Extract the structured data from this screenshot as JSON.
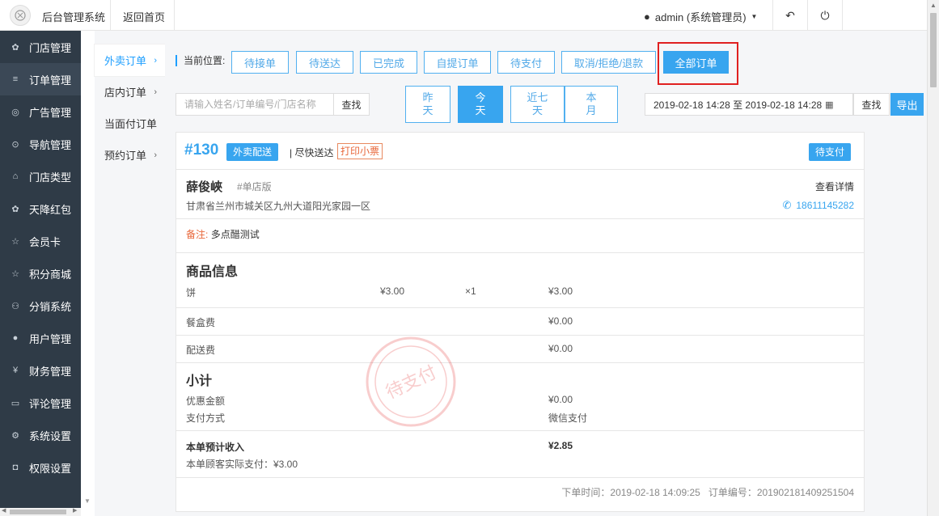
{
  "header": {
    "app_title": "后台管理系统",
    "back_home": "返回首页",
    "user": "admin (系统管理员)",
    "back_icon": "↶",
    "power_icon": "⏻"
  },
  "sidebar": {
    "items": [
      {
        "icon": "✿",
        "label": "门店管理"
      },
      {
        "icon": "≡",
        "label": "订单管理"
      },
      {
        "icon": "◎",
        "label": "广告管理"
      },
      {
        "icon": "⊙",
        "label": "导航管理"
      },
      {
        "icon": "⌂",
        "label": "门店类型"
      },
      {
        "icon": "✿",
        "label": "天降红包"
      },
      {
        "icon": "☆",
        "label": "会员卡"
      },
      {
        "icon": "☆",
        "label": "积分商城"
      },
      {
        "icon": "⚇",
        "label": "分销系统"
      },
      {
        "icon": "●",
        "label": "用户管理"
      },
      {
        "icon": "¥",
        "label": "财务管理"
      },
      {
        "icon": "▭",
        "label": "评论管理"
      },
      {
        "icon": "⚙",
        "label": "系统设置"
      },
      {
        "icon": "◘",
        "label": "权限设置"
      }
    ]
  },
  "subnav": {
    "items": [
      {
        "label": "外卖订单",
        "chev": "›"
      },
      {
        "label": "店内订单",
        "chev": "›"
      },
      {
        "label": "当面付订单",
        "chev": ""
      },
      {
        "label": "预约订单",
        "chev": "›"
      }
    ]
  },
  "filters": {
    "position_label": "当前位置:",
    "tabs": [
      "待接单",
      "待送达",
      "已完成",
      "自提订单",
      "待支付",
      "取消/拒绝/退款",
      "全部订单"
    ],
    "search_placeholder": "请输入姓名/订单编号/门店名称",
    "search_button": "查找",
    "days": [
      {
        "l1": "昨",
        "l2": "天"
      },
      {
        "l1": "今",
        "l2": "天"
      },
      {
        "l1": "近七",
        "l2": "天"
      },
      {
        "l1": "本",
        "l2": "月"
      }
    ],
    "date_range": "2019-02-18 14:28 至 2019-02-18 14:28",
    "date_search_button": "查找",
    "export_button": "导出"
  },
  "order": {
    "number": "#130",
    "type": "外卖配送",
    "delivery": "| 尽快送达",
    "print": "打印小票",
    "status": "待支付",
    "customer_name": "薛俊峽",
    "store_tag": "#单店版",
    "view_detail": "查看详情",
    "address": "甘肃省兰州市城关区九州大道阳光家园一区",
    "phone": "18611145282",
    "remark_label": "备注:",
    "remark": "多点醋测试",
    "goods_title": "商品信息",
    "goods": [
      {
        "name": "饼",
        "price": "¥3.00",
        "qty": "×1",
        "total": "¥3.00"
      }
    ],
    "box_fee_label": "餐盒费",
    "box_fee": "¥0.00",
    "delivery_fee_label": "配送费",
    "delivery_fee": "¥0.00",
    "subtotal_title": "小计",
    "discount_label": "优惠金额",
    "discount": "¥0.00",
    "pay_method_label": "支付方式",
    "pay_method": "微信支付",
    "income_label": "本单预计收入",
    "income": "¥2.85",
    "customer_paid": "本单顾客实际支付：¥3.00",
    "stamp_text": "待支付",
    "order_time": "下单时间：2019-02-18 14:09:25",
    "order_id": "订单编号：201902181409251504"
  }
}
